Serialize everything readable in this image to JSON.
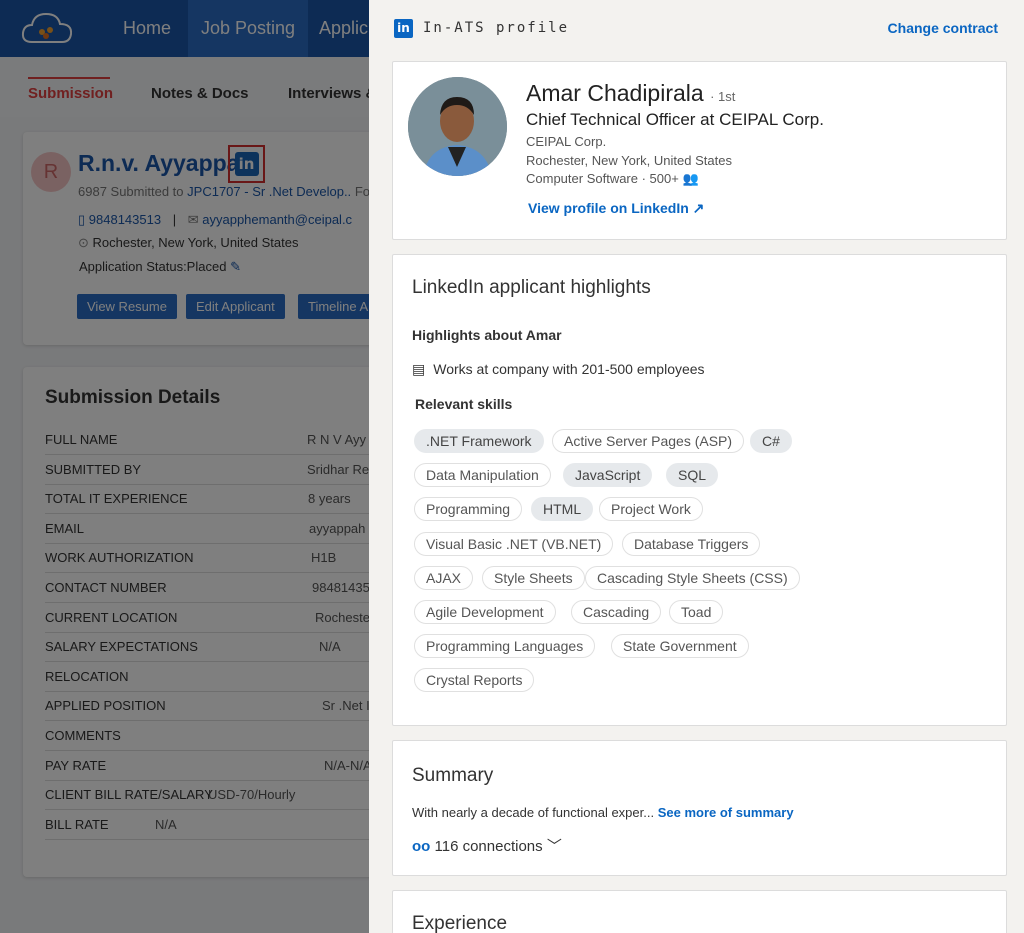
{
  "nav": {
    "home": "Home",
    "job_posting": "Job Posting",
    "applicants": "Applic"
  },
  "subtabs": {
    "submission": "Submission",
    "notes": "Notes & Docs",
    "interviews": "Interviews &"
  },
  "candidate": {
    "initial": "R",
    "name": "R.n.v. Ayyappa",
    "submitted_prefix": "6987 Submitted to",
    "job_link": "JPC1707 - Sr .Net Develop..",
    "submitted_suffix": "Fo",
    "phone": "9848143513",
    "separator": "|",
    "email": "ayyapphemanth@ceipal.c",
    "location": "Rochester,  New York,  United States",
    "status": "Application Status:Placed"
  },
  "buttons": {
    "view_resume": "View Resume",
    "edit_applicant": "Edit Applicant",
    "timeline": "Timeline A"
  },
  "details": {
    "title": "Submission Details",
    "rows": [
      {
        "label": "FULL NAME",
        "value": "R N V Ayy"
      },
      {
        "label": "SUBMITTED BY",
        "value": "Sridhar Re"
      },
      {
        "label": "TOTAL IT EXPERIENCE",
        "value": "8 years"
      },
      {
        "label": "EMAIL",
        "value": "ayyappah"
      },
      {
        "label": "WORK AUTHORIZATION",
        "value": "H1B"
      },
      {
        "label": "CONTACT NUMBER",
        "value": "98481435"
      },
      {
        "label": "CURRENT LOCATION",
        "value": "Rocheste"
      },
      {
        "label": "SALARY EXPECTATIONS",
        "value": "N/A"
      },
      {
        "label": "RELOCATION",
        "value": ""
      },
      {
        "label": "APPLIED POSITION",
        "value": "Sr .Net I"
      },
      {
        "label": "COMMENTS",
        "value": ""
      },
      {
        "label": "PAY RATE",
        "value": "N/A-N/A"
      },
      {
        "label": "CLIENT BILL RATE/SALARY",
        "value": "USD-70/Hourly"
      },
      {
        "label": "BILL RATE",
        "value": "N/A"
      }
    ]
  },
  "panel": {
    "title": "In-ATS profile",
    "change_contract": "Change contract",
    "profile": {
      "name": "Amar Chadipirala",
      "degree": "· 1st",
      "headline": "Chief Technical Officer at CEIPAL Corp.",
      "company": "CEIPAL Corp.",
      "location": "Rochester, New York, United States",
      "industry": "Computer Software · 500+",
      "view_link": "View profile on LinkedIn"
    },
    "highlights": {
      "title": "LinkedIn applicant highlights",
      "about": "Highlights about Amar",
      "item": "Works at company with 201-500 employees",
      "skills_title": "Relevant skills",
      "skills": [
        ".NET Framework",
        "Active Server Pages (ASP)",
        "C#",
        "Data Manipulation",
        "JavaScript",
        "SQL",
        "Programming",
        "HTML",
        "Project Work",
        "Visual Basic .NET (VB.NET)",
        "Database Triggers",
        "AJAX",
        "Style Sheets",
        "Cascading Style Sheets (CSS)",
        "Agile Development",
        "Cascading",
        "Toad",
        "Programming Languages",
        "State Government",
        "Crystal Reports"
      ]
    },
    "summary": {
      "title": "Summary",
      "text": "With nearly a decade of functional exper...",
      "see_more": "See more of summary",
      "connections": "116 connections"
    },
    "experience": {
      "title": "Experience"
    }
  },
  "colors": {
    "brand_blue": "#1a56a8",
    "linkedin_blue": "#0a66c2",
    "accent_red": "#e04040"
  }
}
